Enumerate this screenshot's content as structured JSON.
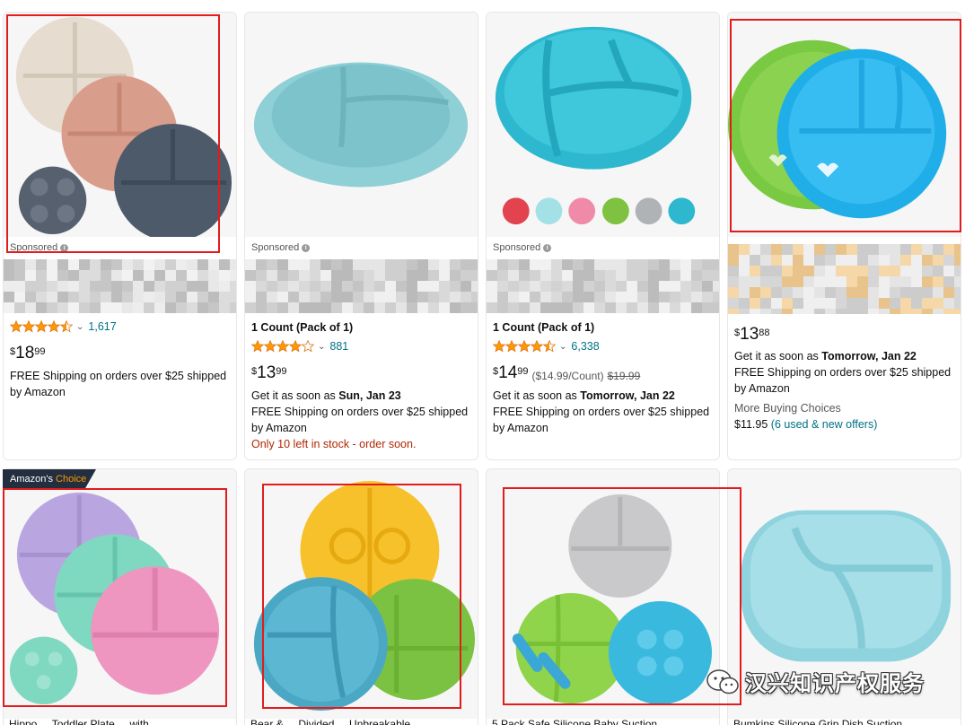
{
  "cards": [
    {
      "sponsored": "Sponsored",
      "pack": "",
      "rating_count": "1,617",
      "price_symbol": "$",
      "price_whole": "18",
      "price_fraction": "99",
      "price_extra": "",
      "price_strike": "",
      "delivery_prefix": "",
      "delivery_date": "",
      "shipping_line1": "FREE Shipping on orders over $25 shipped",
      "shipping_line2": "by Amazon",
      "stock_note": "",
      "more_buying": "",
      "more_price": "",
      "more_offers": ""
    },
    {
      "sponsored": "Sponsored",
      "pack": "1 Count (Pack of 1)",
      "rating_count": "881",
      "price_symbol": "$",
      "price_whole": "13",
      "price_fraction": "99",
      "price_extra": "",
      "price_strike": "",
      "delivery_prefix": "Get it as soon as ",
      "delivery_date": "Sun, Jan 23",
      "shipping_line1": "FREE Shipping on orders over $25 shipped",
      "shipping_line2": "by Amazon",
      "stock_note": "Only 10 left in stock - order soon.",
      "more_buying": "",
      "more_price": "",
      "more_offers": ""
    },
    {
      "sponsored": "Sponsored",
      "pack": "1 Count (Pack of 1)",
      "rating_count": "6,338",
      "price_symbol": "$",
      "price_whole": "14",
      "price_fraction": "99",
      "price_extra": "($14.99/Count)",
      "price_strike": "$19.99",
      "delivery_prefix": "Get it as soon as ",
      "delivery_date": "Tomorrow, Jan 22",
      "shipping_line1": "FREE Shipping on orders over $25 shipped",
      "shipping_line2": "by Amazon",
      "stock_note": "",
      "more_buying": "",
      "more_price": "",
      "more_offers": ""
    },
    {
      "sponsored": "",
      "pack": "",
      "rating_count": "",
      "price_symbol": "$",
      "price_whole": "13",
      "price_fraction": "88",
      "price_extra": "",
      "price_strike": "",
      "delivery_prefix": "Get it as soon as ",
      "delivery_date": "Tomorrow, Jan 22",
      "shipping_line1": "FREE Shipping on orders over $25 shipped",
      "shipping_line2": "by Amazon",
      "stock_note": "",
      "more_buying": "More Buying Choices",
      "more_price": "$11.95",
      "more_offers": "(6 used & new offers)"
    }
  ],
  "badge": {
    "prefix": "Amazon's",
    "suffix": "Choice"
  },
  "bottom_titles": [
    "Hippo ... Toddler Plate ... with",
    "Bear & ... Divided ... Unbreakable",
    "5 Pack Safe Silicone Baby Suction",
    "Bumkins Silicone Grip Dish Suction"
  ],
  "watermark": "汉兴知识产权服务",
  "colors": {
    "accent_orange": "#ff9900",
    "link_teal": "#007185",
    "price_text": "#0f1111",
    "stock_red": "#b12704",
    "annotation_red": "#e21c1c",
    "badge_navy": "#232f3e"
  }
}
